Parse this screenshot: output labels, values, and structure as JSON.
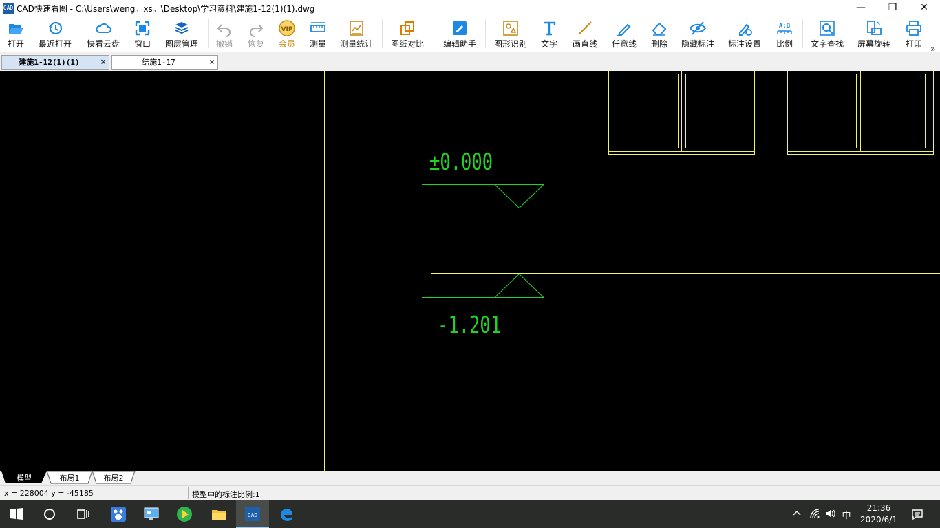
{
  "window": {
    "title": "CAD快速看图 - C:\\Users\\weng。xs。\\Desktop\\学习资料\\建施1-12(1)(1).dwg",
    "app_icon_text": "CAD",
    "minimize": "—",
    "maximize": "❐",
    "close": "✕"
  },
  "toolbar": [
    {
      "label": "打开",
      "icon": "open-folder-icon"
    },
    {
      "label": "最近打开",
      "icon": "recent-history-icon"
    },
    {
      "label": "快看云盘",
      "icon": "cloud-icon"
    },
    {
      "label": "窗口",
      "icon": "window-icon"
    },
    {
      "label": "图层管理",
      "icon": "layers-icon"
    },
    {
      "label": "撤销",
      "icon": "undo-icon",
      "disabled": true
    },
    {
      "label": "恢复",
      "icon": "redo-icon",
      "disabled": true
    },
    {
      "label": "会员",
      "icon": "vip-icon",
      "vip": true,
      "badge": "VIP"
    },
    {
      "label": "测量",
      "icon": "ruler-icon"
    },
    {
      "label": "测量统计",
      "icon": "measure-stats-icon"
    },
    {
      "label": "图纸对比",
      "icon": "compare-icon"
    },
    {
      "label": "编辑助手",
      "icon": "edit-assistant-icon"
    },
    {
      "label": "图形识别",
      "icon": "shape-recognition-icon"
    },
    {
      "label": "文字",
      "icon": "text-icon"
    },
    {
      "label": "画直线",
      "icon": "line-icon"
    },
    {
      "label": "任意线",
      "icon": "freehand-pen-icon"
    },
    {
      "label": "删除",
      "icon": "eraser-icon"
    },
    {
      "label": "隐藏标注",
      "icon": "hide-eye-icon"
    },
    {
      "label": "标注设置",
      "icon": "annotation-settings-icon"
    },
    {
      "label": "比例",
      "icon": "scale-icon",
      "badge": "A:B"
    },
    {
      "label": "文字查找",
      "icon": "text-search-icon"
    },
    {
      "label": "屏幕旋转",
      "icon": "screen-rotate-icon"
    },
    {
      "label": "打印",
      "icon": "printer-icon"
    }
  ],
  "toolbar_more": "»",
  "tabs": [
    {
      "label": "建施1-12(1)(1)",
      "active": true,
      "close": "×"
    },
    {
      "label": "结施1-17",
      "active": false,
      "close": "×"
    }
  ],
  "drawing": {
    "elevation_top": "±0.000",
    "elevation_bottom": "-1.201",
    "colors": {
      "green": "#21d321",
      "yellow": "#f0f06a",
      "background": "#000000"
    }
  },
  "layout_tabs": [
    {
      "label": "模型",
      "active": true
    },
    {
      "label": "布局1",
      "active": false
    },
    {
      "label": "布局2",
      "active": false
    }
  ],
  "status": {
    "coords": "x = 228004  y = -45185",
    "scale": "模型中的标注比例:1"
  },
  "taskbar": {
    "apps": [
      "windows-start-icon",
      "cortana-search-icon",
      "task-view-icon",
      "baidu-netdisk-icon",
      "remote-desktop-icon",
      "media-player-icon",
      "file-explorer-icon",
      "cad-viewer-icon",
      "edge-icon"
    ],
    "ime": "中",
    "time": "21:36",
    "date": "2020/6/1"
  }
}
